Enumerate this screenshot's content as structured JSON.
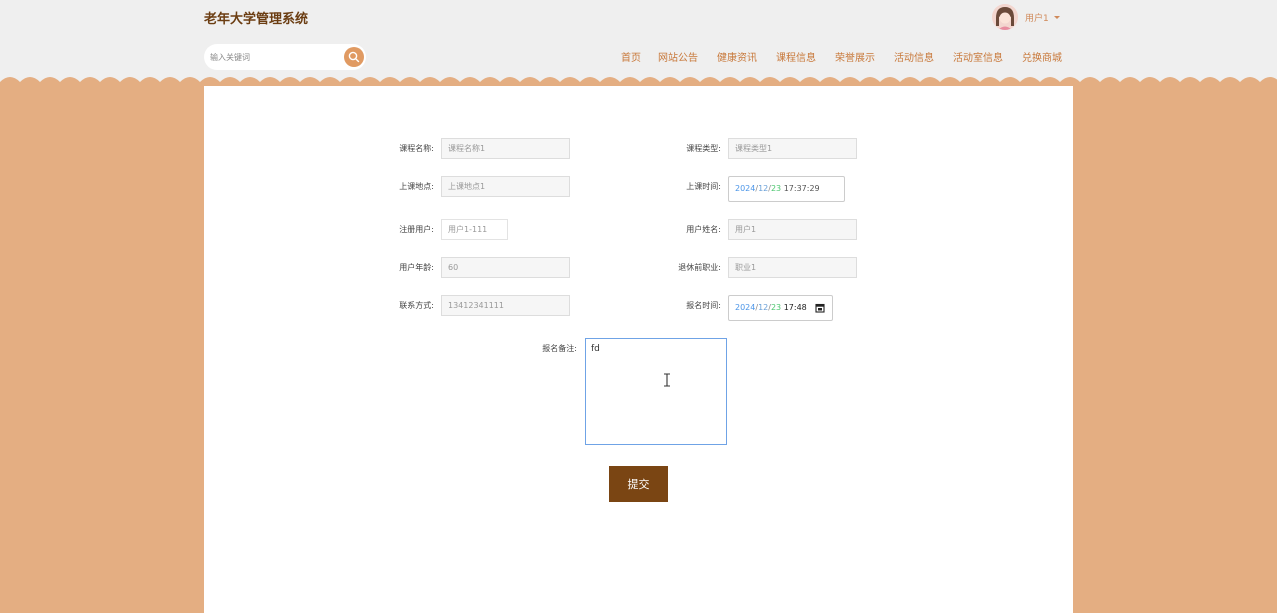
{
  "header": {
    "title": "老年大学管理系统",
    "user_name": "用户1",
    "search_placeholder": "输入关键词"
  },
  "nav": [
    "首页",
    "网站公告",
    "健康资讯",
    "课程信息",
    "荣誉展示",
    "活动信息",
    "活动室信息",
    "兑换商城"
  ],
  "form": {
    "course_name": {
      "label": "课程名称:",
      "value": "课程名称1"
    },
    "course_type": {
      "label": "课程类型:",
      "value": "课程类型1"
    },
    "location": {
      "label": "上课地点:",
      "value": "上课地点1"
    },
    "class_time": {
      "label": "上课时间:",
      "year": "2024",
      "month": "12",
      "day": "23",
      "time": "17:37:29"
    },
    "user_account": {
      "label": "注册用户:",
      "value": "用户1-111"
    },
    "user_name": {
      "label": "用户姓名:",
      "value": "用户1"
    },
    "user_age": {
      "label": "用户年龄:",
      "value": "60"
    },
    "occupation": {
      "label": "退休前职业:",
      "value": "职业1"
    },
    "contact": {
      "label": "联系方式:",
      "value": "13412341111"
    },
    "signup_time": {
      "label": "报名时间:",
      "year": "2024",
      "month": "12",
      "day": "23",
      "time": "17:48"
    },
    "remark": {
      "label": "报名备注:",
      "value": "fd"
    },
    "submit_label": "提交"
  },
  "colors": {
    "background": "#e4ae82",
    "brand": "#6b3d12",
    "nav_text": "#c8783a",
    "submit": "#7a4513"
  }
}
